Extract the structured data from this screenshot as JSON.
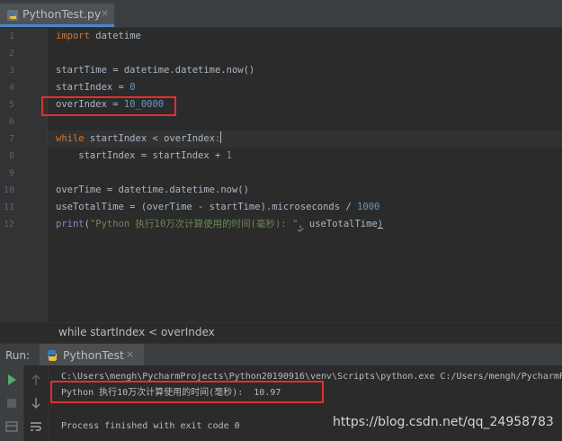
{
  "editor_tab": {
    "label": "PythonTest.py",
    "close": "×"
  },
  "editor": {
    "line_numbers": [
      "1",
      "2",
      "3",
      "4",
      "5",
      "6",
      "7",
      "8",
      "9",
      "10",
      "11",
      "12"
    ],
    "lines": {
      "l1_kw": "import",
      "l1_rest": " datetime",
      "l3": "startTime = datetime.datetime.now()",
      "l4_a": "startIndex = ",
      "l4_num": "0",
      "l5_a": "overIndex = ",
      "l5_num": "10_0000",
      "l7_kw": "while",
      "l7_rest": " startIndex < overIndex",
      "l7_colon": ":",
      "l8_a": "    startIndex = startIndex + ",
      "l8_num": "1",
      "l10": "overTime = datetime.datetime.now()",
      "l11_a": "useTotalTime = (overTime - startTime).microseconds / ",
      "l11_num": "1000",
      "l12_fn": "print",
      "l12_paren": "(",
      "l12_str": "\"Python 执行10万次计算使用的时间(毫秒): \"",
      "l12_comma": ",",
      "l12_rest": " useTotalTime",
      "l12_close": ")"
    }
  },
  "breadcrumb": "while startIndex < overIndex",
  "run": {
    "title": "Run:",
    "tab_label": "PythonTest",
    "tab_close": "×",
    "console": {
      "command": "C:\\Users\\mengh\\PycharmProjects\\Python20190916\\venv\\Scripts\\python.exe C:/Users/mengh/PycharmP",
      "result": "Python 执行10万次计算使用的时间(毫秒):  10.97",
      "exit": "Process finished with exit code 0"
    }
  },
  "watermark": "https://blog.csdn.net/qq_24958783",
  "colors": {
    "keyword": "#cc7832",
    "number": "#6897bb",
    "string": "#6a8759",
    "highlight_box": "#e03030",
    "run_green": "#59a869"
  },
  "icons": [
    "python-file-icon",
    "close-icon",
    "rerun-icon",
    "stop-icon",
    "scroll-up-icon",
    "scroll-down-icon",
    "soft-wrap-icon"
  ]
}
